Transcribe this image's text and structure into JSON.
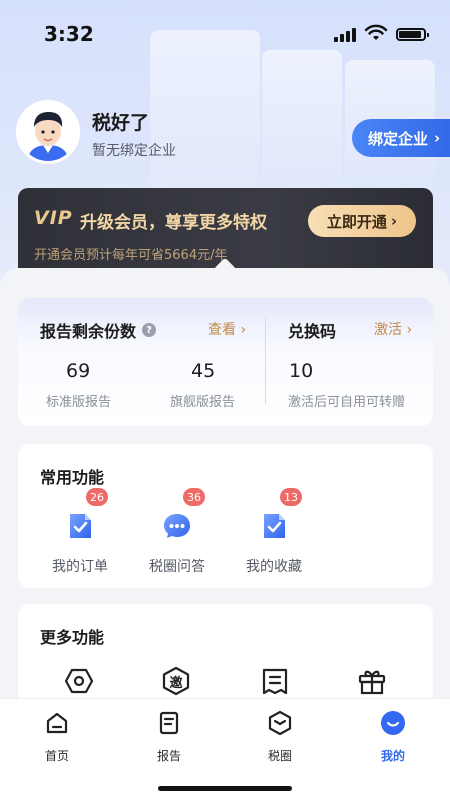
{
  "status_bar": {
    "time": "3:32"
  },
  "profile": {
    "username": "税好了",
    "company_status": "暂无绑定企业",
    "bind_button": "绑定企业"
  },
  "vip": {
    "logo": "VIP",
    "title": "升级会员，尊享更多特权",
    "subtitle": "开通会员预计每年可省5664元/年",
    "button": "立即开通"
  },
  "reports": {
    "title": "报告剩余份数",
    "view_link": "查看",
    "standard": {
      "count": "69",
      "label": "标准版报告"
    },
    "flagship": {
      "count": "45",
      "label": "旗舰版报告"
    }
  },
  "exchange": {
    "title": "兑换码",
    "activate_link": "激活",
    "count": "10",
    "label": "激活后可自用可转赠"
  },
  "common_functions": {
    "title": "常用功能",
    "items": [
      {
        "label": "我的订单",
        "badge": "26",
        "icon": "order-icon"
      },
      {
        "label": "税圈问答",
        "badge": "36",
        "icon": "chat-icon"
      },
      {
        "label": "我的收藏",
        "badge": "13",
        "icon": "favorite-icon"
      }
    ]
  },
  "more_functions": {
    "title": "更多功能",
    "icons": [
      "hexagon-icon",
      "invite-icon",
      "receipt-icon",
      "gift-icon"
    ],
    "invite_glyph": "邀"
  },
  "tabbar": {
    "items": [
      {
        "label": "首页",
        "icon": "home-icon"
      },
      {
        "label": "报告",
        "icon": "report-icon"
      },
      {
        "label": "税圈",
        "icon": "circle-icon"
      },
      {
        "label": "我的",
        "icon": "profile-icon",
        "active": true
      }
    ]
  },
  "colors": {
    "accent": "#3468f0",
    "gold": "#c08a4a",
    "badge": "#ee6a66"
  }
}
